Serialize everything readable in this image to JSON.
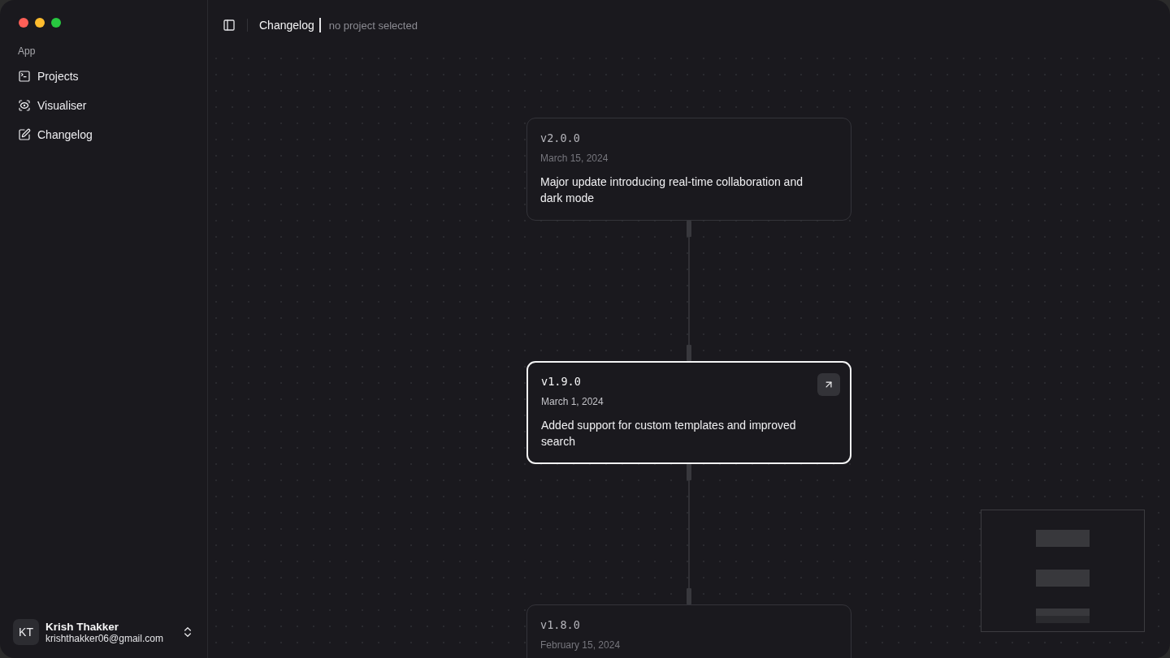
{
  "sidebar": {
    "section_label": "App",
    "items": [
      {
        "label": "Projects",
        "selected": false
      },
      {
        "label": "Visualiser",
        "selected": false
      },
      {
        "label": "Changelog",
        "selected": false
      }
    ],
    "user": {
      "initials": "KT",
      "name": "Krish Thakker",
      "email": "krishthakker06@gmail.com"
    }
  },
  "header": {
    "title": "Changelog",
    "subtitle": "no project selected"
  },
  "nodes": [
    {
      "version": "v2.0.0",
      "date": "March 15, 2024",
      "description": "Major update introducing real-time collaboration and dark mode",
      "selected": false
    },
    {
      "version": "v1.9.0",
      "date": "March 1, 2024",
      "description": "Added support for custom templates and improved search",
      "selected": true
    },
    {
      "version": "v1.8.0",
      "date": "February 15, 2024",
      "selected": false
    }
  ]
}
